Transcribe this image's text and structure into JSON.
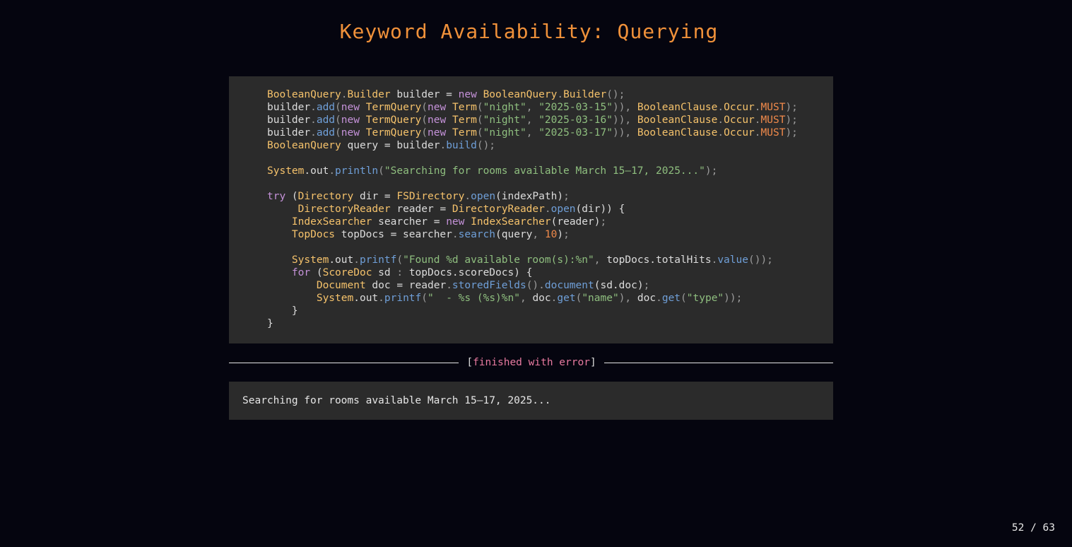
{
  "slide": {
    "title": "Keyword Availability: Querying",
    "page_counter": "52 / 63"
  },
  "code_block": {
    "language": "java",
    "lines": [
      [
        [
          "type",
          "BooleanQuery"
        ],
        [
          "punct",
          "."
        ],
        [
          "type",
          "Builder"
        ],
        [
          "plain",
          " builder = "
        ],
        [
          "kw",
          "new"
        ],
        [
          "plain",
          " "
        ],
        [
          "type",
          "BooleanQuery"
        ],
        [
          "punct",
          "."
        ],
        [
          "type",
          "Builder"
        ],
        [
          "punct",
          "();"
        ]
      ],
      [
        [
          "plain",
          "builder"
        ],
        [
          "punct",
          "."
        ],
        [
          "fn",
          "add"
        ],
        [
          "punct",
          "("
        ],
        [
          "kw",
          "new"
        ],
        [
          "plain",
          " "
        ],
        [
          "type",
          "TermQuery"
        ],
        [
          "punct",
          "("
        ],
        [
          "kw",
          "new"
        ],
        [
          "plain",
          " "
        ],
        [
          "type",
          "Term"
        ],
        [
          "punct",
          "("
        ],
        [
          "str",
          "\"night\""
        ],
        [
          "punct",
          ", "
        ],
        [
          "str",
          "\"2025-03-15\""
        ],
        [
          "punct",
          ")), "
        ],
        [
          "type",
          "BooleanClause"
        ],
        [
          "punct",
          "."
        ],
        [
          "type",
          "Occur"
        ],
        [
          "punct",
          "."
        ],
        [
          "num",
          "MUST"
        ],
        [
          "punct",
          ");"
        ]
      ],
      [
        [
          "plain",
          "builder"
        ],
        [
          "punct",
          "."
        ],
        [
          "fn",
          "add"
        ],
        [
          "punct",
          "("
        ],
        [
          "kw",
          "new"
        ],
        [
          "plain",
          " "
        ],
        [
          "type",
          "TermQuery"
        ],
        [
          "punct",
          "("
        ],
        [
          "kw",
          "new"
        ],
        [
          "plain",
          " "
        ],
        [
          "type",
          "Term"
        ],
        [
          "punct",
          "("
        ],
        [
          "str",
          "\"night\""
        ],
        [
          "punct",
          ", "
        ],
        [
          "str",
          "\"2025-03-16\""
        ],
        [
          "punct",
          ")), "
        ],
        [
          "type",
          "BooleanClause"
        ],
        [
          "punct",
          "."
        ],
        [
          "type",
          "Occur"
        ],
        [
          "punct",
          "."
        ],
        [
          "num",
          "MUST"
        ],
        [
          "punct",
          ");"
        ]
      ],
      [
        [
          "plain",
          "builder"
        ],
        [
          "punct",
          "."
        ],
        [
          "fn",
          "add"
        ],
        [
          "punct",
          "("
        ],
        [
          "kw",
          "new"
        ],
        [
          "plain",
          " "
        ],
        [
          "type",
          "TermQuery"
        ],
        [
          "punct",
          "("
        ],
        [
          "kw",
          "new"
        ],
        [
          "plain",
          " "
        ],
        [
          "type",
          "Term"
        ],
        [
          "punct",
          "("
        ],
        [
          "str",
          "\"night\""
        ],
        [
          "punct",
          ", "
        ],
        [
          "str",
          "\"2025-03-17\""
        ],
        [
          "punct",
          ")), "
        ],
        [
          "type",
          "BooleanClause"
        ],
        [
          "punct",
          "."
        ],
        [
          "type",
          "Occur"
        ],
        [
          "punct",
          "."
        ],
        [
          "num",
          "MUST"
        ],
        [
          "punct",
          ");"
        ]
      ],
      [
        [
          "type",
          "BooleanQuery"
        ],
        [
          "plain",
          " query = builder"
        ],
        [
          "punct",
          "."
        ],
        [
          "fn",
          "build"
        ],
        [
          "punct",
          "();"
        ]
      ],
      [],
      [
        [
          "type",
          "System"
        ],
        [
          "plain",
          ".out"
        ],
        [
          "punct",
          "."
        ],
        [
          "fn",
          "println"
        ],
        [
          "punct",
          "("
        ],
        [
          "str",
          "\"Searching for rooms available March 15–17, 2025...\""
        ],
        [
          "punct",
          ");"
        ]
      ],
      [],
      [
        [
          "kw",
          "try"
        ],
        [
          "plain",
          " ("
        ],
        [
          "type",
          "Directory"
        ],
        [
          "plain",
          " dir = "
        ],
        [
          "type",
          "FSDirectory"
        ],
        [
          "punct",
          "."
        ],
        [
          "fn",
          "open"
        ],
        [
          "plain",
          "(indexPath)"
        ],
        [
          "punct",
          ";"
        ]
      ],
      [
        [
          "plain",
          "     "
        ],
        [
          "type",
          "DirectoryReader"
        ],
        [
          "plain",
          " reader = "
        ],
        [
          "type",
          "DirectoryReader"
        ],
        [
          "punct",
          "."
        ],
        [
          "fn",
          "open"
        ],
        [
          "plain",
          "(dir)) {"
        ]
      ],
      [
        [
          "plain",
          "    "
        ],
        [
          "type",
          "IndexSearcher"
        ],
        [
          "plain",
          " searcher = "
        ],
        [
          "kw",
          "new"
        ],
        [
          "plain",
          " "
        ],
        [
          "type",
          "IndexSearcher"
        ],
        [
          "plain",
          "(reader)"
        ],
        [
          "punct",
          ";"
        ]
      ],
      [
        [
          "plain",
          "    "
        ],
        [
          "type",
          "TopDocs"
        ],
        [
          "plain",
          " topDocs = searcher"
        ],
        [
          "punct",
          "."
        ],
        [
          "fn",
          "search"
        ],
        [
          "plain",
          "(query"
        ],
        [
          "punct",
          ", "
        ],
        [
          "num",
          "10"
        ],
        [
          "plain",
          ")"
        ],
        [
          "punct",
          ";"
        ]
      ],
      [],
      [
        [
          "plain",
          "    "
        ],
        [
          "type",
          "System"
        ],
        [
          "plain",
          ".out"
        ],
        [
          "punct",
          "."
        ],
        [
          "fn",
          "printf"
        ],
        [
          "punct",
          "("
        ],
        [
          "str",
          "\"Found %d available room(s):%n\""
        ],
        [
          "punct",
          ", "
        ],
        [
          "plain",
          "topDocs.totalHits"
        ],
        [
          "punct",
          "."
        ],
        [
          "fn",
          "value"
        ],
        [
          "punct",
          "());"
        ]
      ],
      [
        [
          "plain",
          "    "
        ],
        [
          "kw",
          "for"
        ],
        [
          "plain",
          " ("
        ],
        [
          "type",
          "ScoreDoc"
        ],
        [
          "plain",
          " sd "
        ],
        [
          "punct",
          ":"
        ],
        [
          "plain",
          " topDocs.scoreDocs) {"
        ]
      ],
      [
        [
          "plain",
          "        "
        ],
        [
          "type",
          "Document"
        ],
        [
          "plain",
          " doc = reader"
        ],
        [
          "punct",
          "."
        ],
        [
          "fn",
          "storedFields"
        ],
        [
          "punct",
          "()."
        ],
        [
          "fn",
          "document"
        ],
        [
          "plain",
          "(sd.doc)"
        ],
        [
          "punct",
          ";"
        ]
      ],
      [
        [
          "plain",
          "        "
        ],
        [
          "type",
          "System"
        ],
        [
          "plain",
          ".out"
        ],
        [
          "punct",
          "."
        ],
        [
          "fn",
          "printf"
        ],
        [
          "punct",
          "("
        ],
        [
          "str",
          "\"  - %s (%s)%n\""
        ],
        [
          "punct",
          ", "
        ],
        [
          "plain",
          "doc"
        ],
        [
          "punct",
          "."
        ],
        [
          "fn",
          "get"
        ],
        [
          "punct",
          "("
        ],
        [
          "str",
          "\"name\""
        ],
        [
          "punct",
          "), "
        ],
        [
          "plain",
          "doc"
        ],
        [
          "punct",
          "."
        ],
        [
          "fn",
          "get"
        ],
        [
          "punct",
          "("
        ],
        [
          "str",
          "\"type\""
        ],
        [
          "punct",
          "));"
        ]
      ],
      [
        [
          "plain",
          "    }"
        ]
      ],
      [
        [
          "plain",
          "}"
        ]
      ]
    ]
  },
  "status": {
    "open_bracket": "[",
    "text": "finished with error",
    "close_bracket": "]"
  },
  "output": {
    "text": "Searching for rooms available March 15–17, 2025..."
  }
}
